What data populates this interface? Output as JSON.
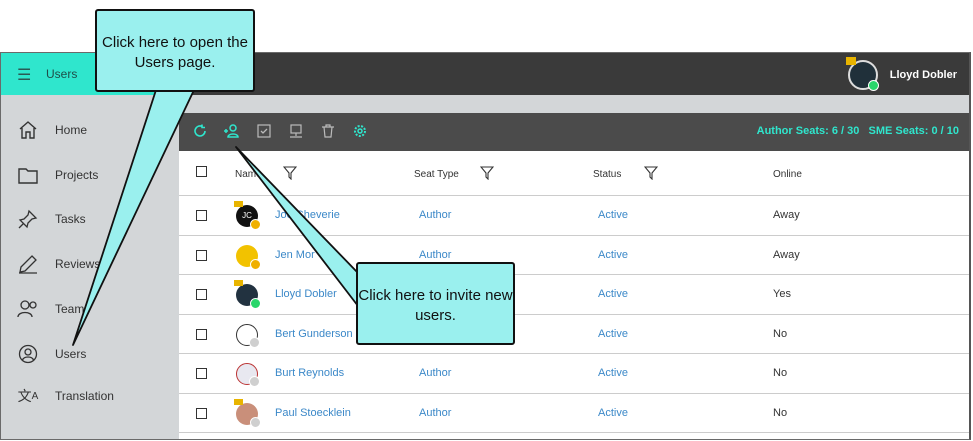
{
  "header": {
    "menu_icon": "hamburger-icon",
    "title": "Users",
    "user_name": "Lloyd Dobler"
  },
  "sidebar": {
    "items": [
      {
        "label": "Home",
        "icon": "home-icon"
      },
      {
        "label": "Projects",
        "icon": "folder-icon"
      },
      {
        "label": "Tasks",
        "icon": "pin-icon"
      },
      {
        "label": "Reviews",
        "icon": "pen-icon"
      },
      {
        "label": "Team",
        "icon": "team-icon"
      },
      {
        "label": "Users",
        "icon": "user-circle-icon"
      },
      {
        "label": "Translation",
        "icon": "translate-icon"
      }
    ]
  },
  "toolbar": {
    "icons": [
      "refresh-icon",
      "invite-user-icon",
      "approve-icon",
      "computer-icon",
      "trash-icon",
      "settings-icon"
    ],
    "seats_text": "Author Seats: 6 / 30   SME Seats: 0 / 10"
  },
  "table": {
    "columns": [
      "Name",
      "Seat Type",
      "Status",
      "Online"
    ],
    "rows": [
      {
        "initials": "JC",
        "name": "Joe Cheverie",
        "seat": "Author",
        "status": "Active",
        "online": "Away"
      },
      {
        "initials": "",
        "name": "Jen Mor",
        "seat": "Author",
        "status": "Active",
        "online": "Away"
      },
      {
        "initials": "",
        "name": "Lloyd Dobler",
        "seat": "",
        "status": "Active",
        "online": "Yes"
      },
      {
        "initials": "",
        "name": "Bert Gunderson",
        "seat": "",
        "status": "Active",
        "online": "No"
      },
      {
        "initials": "",
        "name": "Burt Reynolds",
        "seat": "Author",
        "status": "Active",
        "online": "No"
      },
      {
        "initials": "",
        "name": "Paul Stoecklein",
        "seat": "Author",
        "status": "Active",
        "online": "No"
      }
    ]
  },
  "callouts": {
    "users_page": "Click here to open the Users page.",
    "invite": "Click here to invite new users."
  },
  "colors": {
    "accent": "#2fe6cd",
    "link": "#3b88c8",
    "callout": "#9af0ee",
    "away": "#f0b000",
    "online": "#29d66a",
    "offline": "#cfcfcf"
  }
}
